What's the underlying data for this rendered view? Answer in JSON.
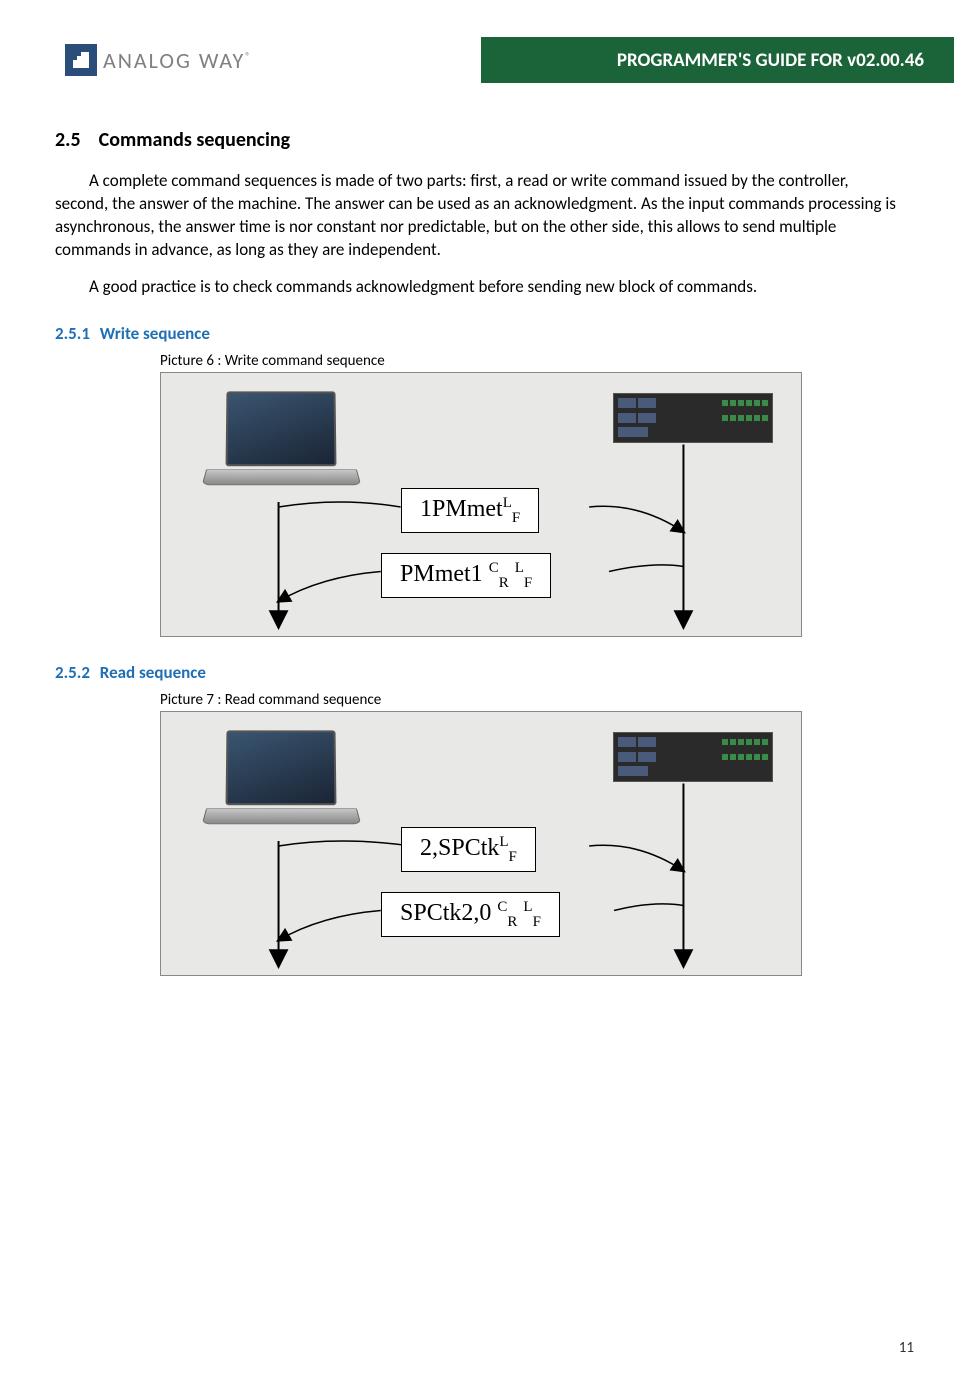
{
  "header": {
    "logo_text": "ANALOG WAY",
    "logo_mark": "®",
    "title": "PROGRAMMER'S GUIDE FOR v02.00.46"
  },
  "section": {
    "number": "2.5",
    "title": "Commands sequencing",
    "para1": "A complete command sequences is made of two parts: first, a read or write command issued by the controller, second, the answer of the machine. The answer can be used as an acknowledgment. As the input commands processing is asynchronous, the answer time is nor constant nor predictable, but on the other side, this allows to send multiple commands in advance, as long as they are independent.",
    "para2": "A good practice is to check commands acknowledgment before sending new block of commands."
  },
  "sub1": {
    "number": "2.5.1",
    "title": "Write sequence",
    "caption": "Picture 6 : Write command sequence",
    "diagram": {
      "request_cmd": "1PMmet",
      "request_terminator": {
        "sup": "L",
        "sub": "F"
      },
      "response_cmd": "PMmet1",
      "response_terminators": [
        {
          "sup": "C",
          "sub": "R"
        },
        {
          "sup": "L",
          "sub": "F"
        }
      ]
    }
  },
  "sub2": {
    "number": "2.5.2",
    "title": "Read sequence",
    "caption": "Picture 7 : Read command sequence",
    "diagram": {
      "request_cmd": "2,SPCtk",
      "request_terminator": {
        "sup": "L",
        "sub": "F"
      },
      "response_cmd": "SPCtk2,0",
      "response_terminators": [
        {
          "sup": "C",
          "sub": "R"
        },
        {
          "sup": "L",
          "sub": "F"
        }
      ]
    }
  },
  "page_number": "11"
}
